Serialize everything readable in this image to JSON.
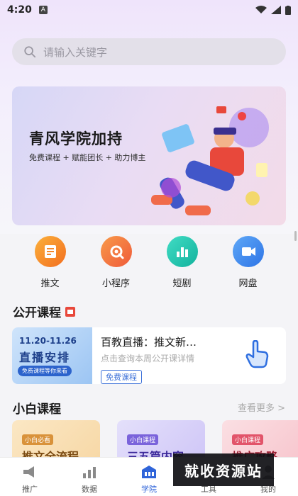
{
  "status_bar": {
    "time": "4:20",
    "notif": "A"
  },
  "search": {
    "placeholder": "请输入关键字"
  },
  "banner": {
    "title": "青风学院加持",
    "subtitle": "免费课程 + 赋能团长 + 助力博主"
  },
  "quick_actions": [
    {
      "label": "推文",
      "icon": "document-icon",
      "color": "#f5892b"
    },
    {
      "label": "小程序",
      "icon": "gear-tools-icon",
      "color": "#f46d3b"
    },
    {
      "label": "短剧",
      "icon": "bar-chart-icon",
      "color": "#1fc7b0"
    },
    {
      "label": "网盘",
      "icon": "video-icon",
      "color": "#3d8ef2"
    }
  ],
  "public_course": {
    "title": "公开课程",
    "card": {
      "thumb_date": "11.20-11.26",
      "thumb_title": "直播安排",
      "thumb_tag": "免费课程等你来看",
      "name": "百教直播：推文新…",
      "desc": "点击查询本周公开课详情",
      "free_label": "免费课程"
    }
  },
  "beginner_course": {
    "title": "小白课程",
    "see_more": "查看更多 >",
    "cards": [
      {
        "tag": "小白必看",
        "title": "推文全流程"
      },
      {
        "tag": "小白课程",
        "title": "三五篇内容"
      },
      {
        "tag": "小白课程",
        "title": "推广攻略"
      }
    ]
  },
  "tabbar": [
    {
      "label": "推广",
      "icon": "megaphone-icon"
    },
    {
      "label": "数据",
      "icon": "chart-icon"
    },
    {
      "label": "学院",
      "icon": "school-icon",
      "active": true
    },
    {
      "label": "工具",
      "icon": "tools-icon"
    },
    {
      "label": "我的",
      "icon": "user-icon"
    }
  ],
  "watermark": "就收资源站"
}
